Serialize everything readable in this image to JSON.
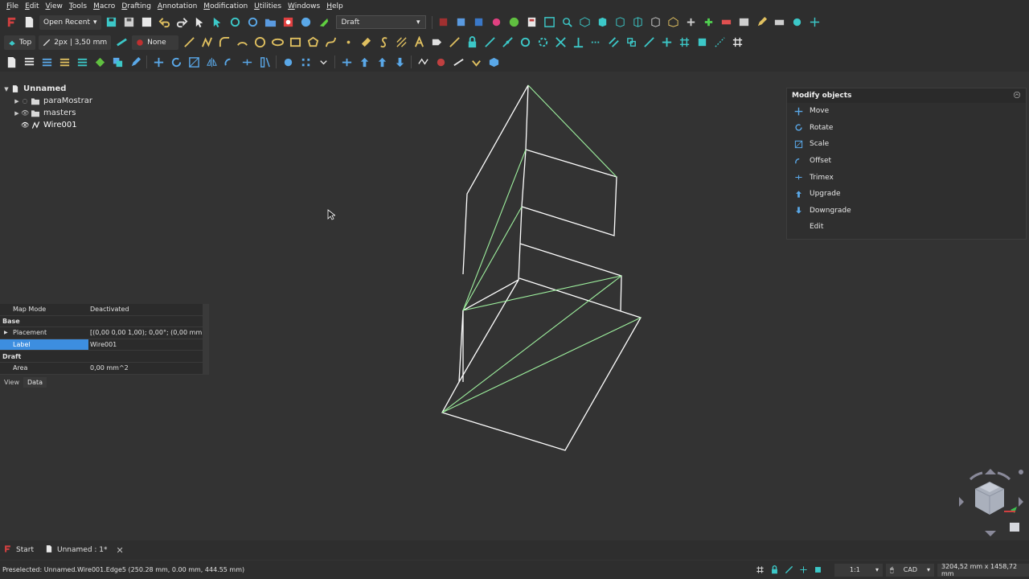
{
  "menu": [
    "File",
    "Edit",
    "View",
    "Tools",
    "Macro",
    "Drafting",
    "Annotation",
    "Modification",
    "Utilities",
    "Windows",
    "Help"
  ],
  "toolbar1": {
    "open_recent_label": "Open Recent",
    "workbench": "Draft"
  },
  "toolbar2": {
    "view_label": "Top",
    "line_style": "2px | 3,50 mm",
    "snap_none": "None"
  },
  "tree": {
    "root": "Unnamed",
    "items": [
      {
        "label": "paraMostrar"
      },
      {
        "label": "masters"
      },
      {
        "label": "Wire001"
      }
    ]
  },
  "properties": {
    "map_mode": {
      "name": "Map Mode",
      "value": "Deactivated"
    },
    "group_base": "Base",
    "placement": {
      "name": "Placement",
      "value": "[(0,00 0,00 1,00); 0,00°; (0,00 mm ..."
    },
    "label": {
      "name": "Label",
      "value": "Wire001"
    },
    "group_draft": "Draft",
    "area": {
      "name": "Area",
      "value": "0,00 mm^2"
    },
    "tabs": [
      "View",
      "Data"
    ]
  },
  "task_panel": {
    "title": "Modify objects",
    "items": [
      "Move",
      "Rotate",
      "Scale",
      "Offset",
      "Trimex",
      "Upgrade",
      "Downgrade",
      "Edit"
    ]
  },
  "doc_tabs": [
    {
      "label": "Start"
    },
    {
      "label": "Unnamed : 1*"
    }
  ],
  "statusbar": {
    "message": "Preselected: Unnamed.Wire001.Edge5 (250.28 mm, 0.00 mm, 444.55 mm)",
    "scale": "1:1",
    "nav_style": "CAD",
    "dimensions": "3204,52 mm x 1458,72 mm"
  },
  "colors": {
    "accent": "#3d8ee0",
    "wire_white": "#ffffff",
    "wire_green": "#9ef09e",
    "toolbar_cyan": "#3cc8c8",
    "background": "#333333"
  }
}
